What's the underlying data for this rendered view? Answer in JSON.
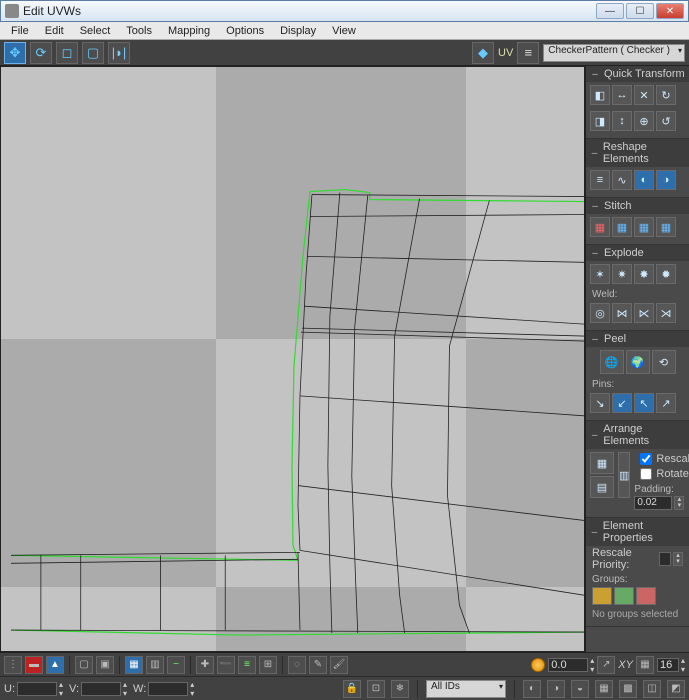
{
  "window": {
    "title": "Edit UVWs"
  },
  "menu": [
    "File",
    "Edit",
    "Select",
    "Tools",
    "Mapping",
    "Options",
    "Display",
    "View"
  ],
  "topbar": {
    "uv_label": "UV",
    "dropdown": "CheckerPattern  ( Checker )"
  },
  "panels": {
    "quick_transform": {
      "title": "Quick Transform"
    },
    "reshape": {
      "title": "Reshape Elements"
    },
    "stitch": {
      "title": "Stitch"
    },
    "explode": {
      "title": "Explode",
      "weld_label": "Weld:"
    },
    "peel": {
      "title": "Peel",
      "pins_label": "Pins:"
    },
    "arrange": {
      "title": "Arrange Elements",
      "rescale": "Rescale",
      "rotate": "Rotate",
      "padding_label": "Padding:",
      "padding_value": "0.02"
    },
    "elemprops": {
      "title": "Element Properties",
      "priority_label": "Rescale Priority:",
      "groups_label": "Groups:",
      "no_groups": "No groups selected"
    }
  },
  "status": {
    "u_label": "U:",
    "u_val": "",
    "v_label": "V:",
    "v_val": "",
    "w_label": "W:",
    "w_val": "",
    "xy_label": "XY",
    "angle_val": "0.0",
    "grid_val": "16",
    "ids_dropdown": "All IDs"
  }
}
